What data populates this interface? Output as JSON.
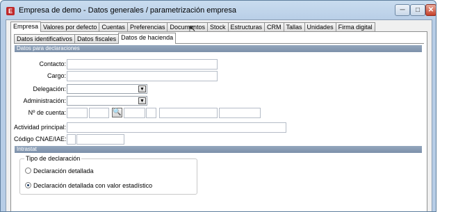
{
  "window": {
    "icon_letter": "E",
    "title": "Empresa de demo - Datos generales / parametrización empresa",
    "minimize": "─",
    "maximize": "□",
    "close": "✕"
  },
  "tabs": [
    "Empresa",
    "Valores por defecto",
    "Cuentas",
    "Preferencias",
    "Documentos",
    "Stock",
    "Estructuras",
    "CRM",
    "Tallas",
    "Unidades",
    "Firma digital"
  ],
  "active_tab": "Empresa",
  "subtabs": [
    "Datos identificativos",
    "Datos fiscales",
    "Datos de hacienda"
  ],
  "active_subtab": "Datos de hacienda",
  "sections": {
    "declaraciones": "Datos para declaraciones",
    "intrastat": "Intrastat"
  },
  "fields": {
    "contacto": {
      "label": "Contacto:",
      "value": ""
    },
    "cargo": {
      "label": "Cargo:",
      "value": ""
    },
    "delegacion": {
      "label": "Delegación:",
      "value": ""
    },
    "administracion": {
      "label": "Administración:",
      "value": ""
    },
    "num_cuenta": {
      "label": "Nº de cuenta:",
      "value": ""
    },
    "actividad": {
      "label": "Actividad principal:",
      "value": ""
    },
    "cnae": {
      "label": "Código CNAE/IAE:",
      "value": ""
    }
  },
  "tipo_declaracion": {
    "title": "Tipo de declaración",
    "options": [
      "Declaración detallada",
      "Declaración detallada con valor estadístico"
    ],
    "selected": "Declaración detallada con valor estadístico"
  },
  "icons": {
    "search": "search-icon",
    "dropdown": "chevron-down-icon"
  },
  "colors": {
    "section_bar": "#8396ae",
    "close_button": "#c6402a"
  }
}
